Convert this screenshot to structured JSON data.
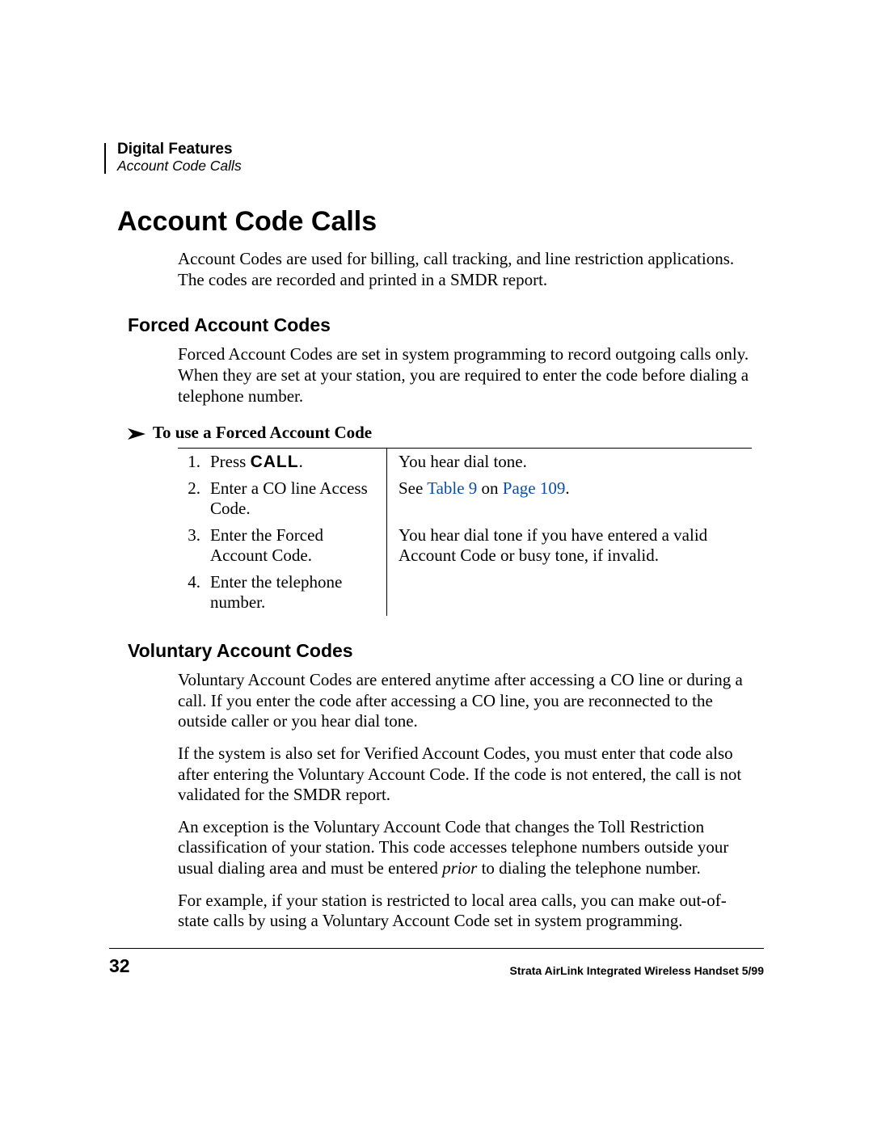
{
  "header": {
    "chapter": "Digital Features",
    "subsection": "Account Code Calls"
  },
  "title": "Account Code Calls",
  "intro": "Account Codes are used for billing, call tracking, and line restriction applications. The codes are recorded and printed in a SMDR report.",
  "forced": {
    "heading": "Forced Account Codes",
    "body": "Forced Account Codes are set in system programming to record outgoing calls only. When they are set at your station, you are required to enter the code before dialing a telephone number.",
    "proc_heading": "To use a Forced Account Code",
    "steps": [
      {
        "num": "1.",
        "action_pre": "Press ",
        "action_key": "CALL",
        "action_post": ".",
        "result": "You hear dial tone."
      },
      {
        "num": "2.",
        "action": "Enter a CO line Access Code.",
        "result_pre": "See ",
        "result_link1": "Table 9",
        "result_mid": " on ",
        "result_link2": "Page 109",
        "result_post": "."
      },
      {
        "num": "3.",
        "action": "Enter the Forced Account Code.",
        "result": "You hear dial tone if you have entered a valid Account Code or busy tone, if invalid."
      },
      {
        "num": "4.",
        "action": "Enter the telephone number.",
        "result": ""
      }
    ]
  },
  "voluntary": {
    "heading": "Voluntary Account Codes",
    "p1": "Voluntary Account Codes are entered anytime after accessing a CO line or during a call. If you enter the code after accessing a CO line, you are reconnected to the outside caller or you hear dial tone.",
    "p2": "If the system is also set for Verified Account Codes, you must enter that code also after entering the Voluntary Account Code. If the code is not entered, the call is not validated for the SMDR report.",
    "p3_a": "An exception is the Voluntary Account Code that changes the Toll Restriction classification of your station. This code accesses telephone numbers outside your usual dialing area and must be entered ",
    "p3_em": "prior",
    "p3_b": " to dialing the telephone number.",
    "p4": "For example, if your station is restricted to local area calls, you can make out-of-state calls by using a Voluntary Account Code set in system programming."
  },
  "footer": {
    "page": "32",
    "text": "Strata AirLink Integrated Wireless Handset   5/99"
  }
}
